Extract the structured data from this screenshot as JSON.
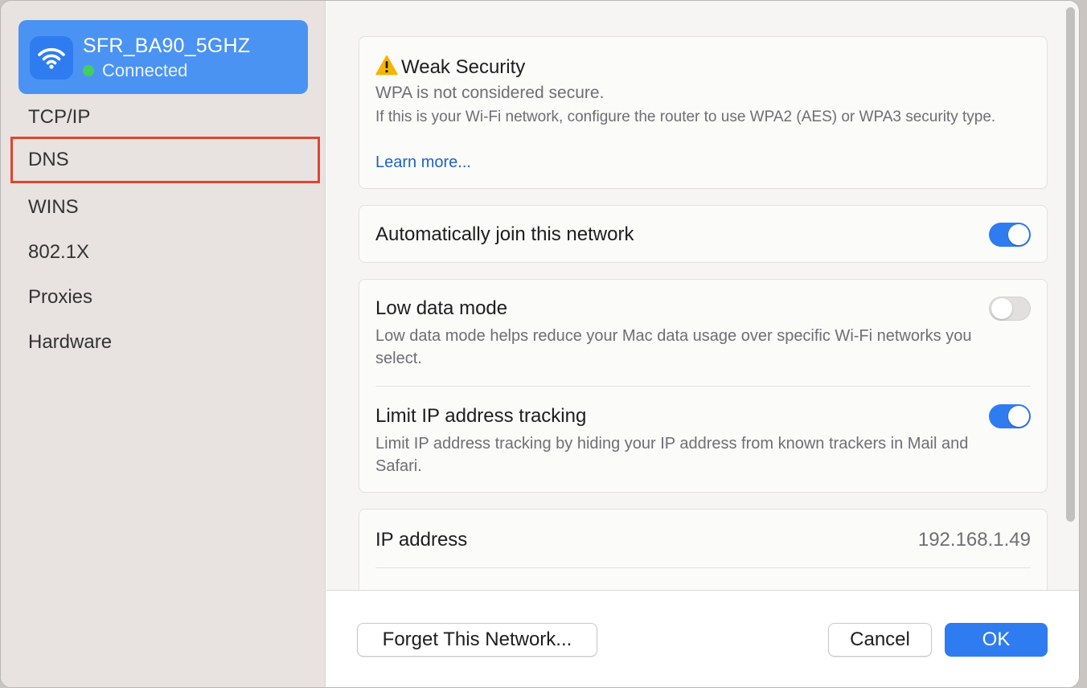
{
  "sidebar": {
    "network": {
      "name": "SFR_BA90_5GHZ",
      "status": "Connected",
      "icon": "wifi-icon"
    },
    "items": [
      {
        "label": "TCP/IP"
      },
      {
        "label": "DNS"
      },
      {
        "label": "WINS"
      },
      {
        "label": "802.1X"
      },
      {
        "label": "Proxies"
      },
      {
        "label": "Hardware"
      }
    ]
  },
  "security": {
    "icon": "warning-icon",
    "title": "Weak Security",
    "subtitle": "WPA is not considered secure.",
    "description": "If this is your Wi-Fi network, configure the router to use WPA2 (AES) or WPA3 security type.",
    "link": "Learn more..."
  },
  "auto_join": {
    "label": "Automatically join this network",
    "enabled": true
  },
  "low_data": {
    "label": "Low data mode",
    "description": "Low data mode helps reduce your Mac data usage over specific Wi-Fi networks you select.",
    "enabled": false
  },
  "limit_ip": {
    "label": "Limit IP address tracking",
    "description": "Limit IP address tracking by hiding your IP address from known trackers in Mail and Safari.",
    "enabled": true
  },
  "ip": {
    "label": "IP address",
    "value": "192.168.1.49"
  },
  "footer": {
    "forget_label": "Forget This Network...",
    "cancel_label": "Cancel",
    "ok_label": "OK"
  },
  "colors": {
    "accent": "#2f7cf0",
    "highlight_border": "#e0452f",
    "connected_dot": "#3fd15b",
    "warning": "#f5b400"
  }
}
